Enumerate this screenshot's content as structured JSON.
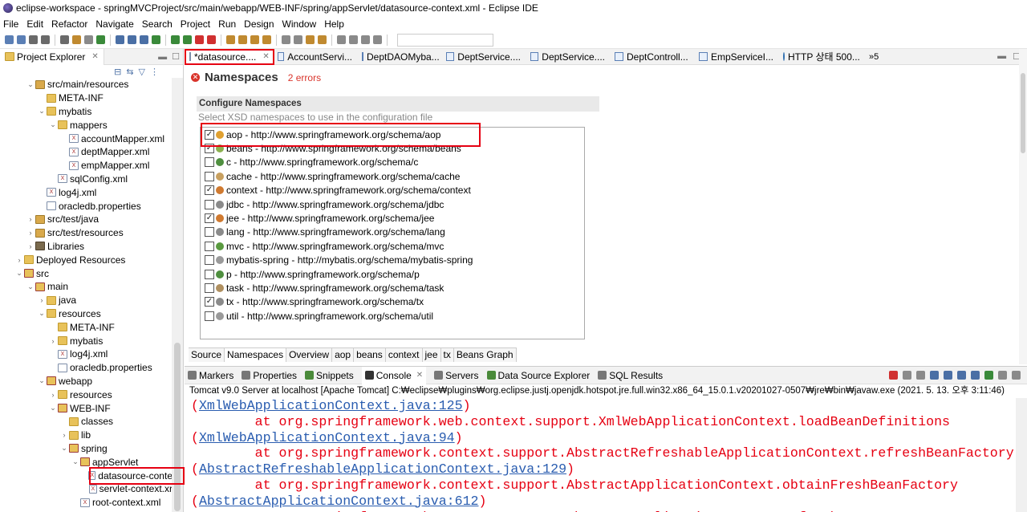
{
  "window": {
    "title": "eclipse-workspace - springMVCProject/src/main/webapp/WEB-INF/spring/appServlet/datasource-context.xml - Eclipse IDE"
  },
  "menu": [
    "File",
    "Edit",
    "Refactor",
    "Navigate",
    "Search",
    "Project",
    "Run",
    "Design",
    "Window",
    "Help"
  ],
  "explorer": {
    "tab_label": "Project Explorer",
    "tree": [
      {
        "label": "src/main/resources",
        "indent": 2,
        "arrow": "v",
        "icon": "pkg"
      },
      {
        "label": "META-INF",
        "indent": 3,
        "arrow": "",
        "icon": "folder"
      },
      {
        "label": "mybatis",
        "indent": 3,
        "arrow": "v",
        "icon": "folder"
      },
      {
        "label": "mappers",
        "indent": 4,
        "arrow": "v",
        "icon": "folder"
      },
      {
        "label": "accountMapper.xml",
        "indent": 5,
        "arrow": "",
        "icon": "xml"
      },
      {
        "label": "deptMapper.xml",
        "indent": 5,
        "arrow": "",
        "icon": "xml"
      },
      {
        "label": "empMapper.xml",
        "indent": 5,
        "arrow": "",
        "icon": "xml"
      },
      {
        "label": "sqlConfig.xml",
        "indent": 4,
        "arrow": "",
        "icon": "xml"
      },
      {
        "label": "log4j.xml",
        "indent": 3,
        "arrow": "",
        "icon": "xml"
      },
      {
        "label": "oracledb.properties",
        "indent": 3,
        "arrow": "",
        "icon": "file"
      },
      {
        "label": "src/test/java",
        "indent": 2,
        "arrow": ">",
        "icon": "pkg"
      },
      {
        "label": "src/test/resources",
        "indent": 2,
        "arrow": ">",
        "icon": "pkg"
      },
      {
        "label": "Libraries",
        "indent": 2,
        "arrow": ">",
        "icon": "lib"
      },
      {
        "label": "Deployed Resources",
        "indent": 1,
        "arrow": ">",
        "icon": "folder"
      },
      {
        "label": "src",
        "indent": 1,
        "arrow": "v",
        "icon": "src"
      },
      {
        "label": "main",
        "indent": 2,
        "arrow": "v",
        "icon": "src"
      },
      {
        "label": "java",
        "indent": 3,
        "arrow": ">",
        "icon": "folder"
      },
      {
        "label": "resources",
        "indent": 3,
        "arrow": "v",
        "icon": "folder"
      },
      {
        "label": "META-INF",
        "indent": 4,
        "arrow": "",
        "icon": "folder"
      },
      {
        "label": "mybatis",
        "indent": 4,
        "arrow": ">",
        "icon": "folder"
      },
      {
        "label": "log4j.xml",
        "indent": 4,
        "arrow": "",
        "icon": "xml"
      },
      {
        "label": "oracledb.properties",
        "indent": 4,
        "arrow": "",
        "icon": "file"
      },
      {
        "label": "webapp",
        "indent": 3,
        "arrow": "v",
        "icon": "src"
      },
      {
        "label": "resources",
        "indent": 4,
        "arrow": ">",
        "icon": "folder"
      },
      {
        "label": "WEB-INF",
        "indent": 4,
        "arrow": "v",
        "icon": "src"
      },
      {
        "label": "classes",
        "indent": 5,
        "arrow": "",
        "icon": "folder"
      },
      {
        "label": "lib",
        "indent": 5,
        "arrow": ">",
        "icon": "folder"
      },
      {
        "label": "spring",
        "indent": 5,
        "arrow": "v",
        "icon": "src"
      },
      {
        "label": "appServlet",
        "indent": 6,
        "arrow": "v",
        "icon": "src"
      },
      {
        "label": "datasource-conte",
        "indent": 7,
        "arrow": "",
        "icon": "xml"
      },
      {
        "label": "servlet-context.xr",
        "indent": 7,
        "arrow": "",
        "icon": "xml"
      },
      {
        "label": "root-context.xml",
        "indent": 6,
        "arrow": "",
        "icon": "xml"
      }
    ]
  },
  "editor": {
    "tabs": [
      {
        "label": "*datasource....",
        "icon": "xml",
        "active": true
      },
      {
        "label": "AccountServi...",
        "icon": "java"
      },
      {
        "label": "DeptDAOMyba...",
        "icon": "java"
      },
      {
        "label": "DeptService....",
        "icon": "java"
      },
      {
        "label": "DeptService....",
        "icon": "java"
      },
      {
        "label": "DeptControll...",
        "icon": "java"
      },
      {
        "label": "EmpServiceI...",
        "icon": "java"
      },
      {
        "label": "HTTP 상태 500...",
        "icon": "globe"
      }
    ],
    "overflow": "»5",
    "page_title": "Namespaces",
    "error_count": "2 errors",
    "section_title": "Configure Namespaces",
    "section_desc": "Select XSD namespaces to use in the configuration file",
    "namespaces": [
      {
        "label": "aop - http://www.springframework.org/schema/aop",
        "checked": true,
        "color": "#e0a030"
      },
      {
        "label": "beans - http://www.springframework.org/schema/beans",
        "checked": true,
        "color": "#8bb04f"
      },
      {
        "label": "c - http://www.springframework.org/schema/c",
        "checked": false,
        "color": "#4f8f3f"
      },
      {
        "label": "cache - http://www.springframework.org/schema/cache",
        "checked": false,
        "color": "#c8a060"
      },
      {
        "label": "context - http://www.springframework.org/schema/context",
        "checked": true,
        "color": "#d07a30"
      },
      {
        "label": "jdbc - http://www.springframework.org/schema/jdbc",
        "checked": false,
        "color": "#8a8a8a"
      },
      {
        "label": "jee - http://www.springframework.org/schema/jee",
        "checked": true,
        "color": "#d07a30"
      },
      {
        "label": "lang - http://www.springframework.org/schema/lang",
        "checked": false,
        "color": "#8a8a8a"
      },
      {
        "label": "mvc - http://www.springframework.org/schema/mvc",
        "checked": false,
        "color": "#5a9a40"
      },
      {
        "label": "mybatis-spring - http://mybatis.org/schema/mybatis-spring",
        "checked": false,
        "color": "#9a9a9a"
      },
      {
        "label": "p - http://www.springframework.org/schema/p",
        "checked": false,
        "color": "#4f8f3f"
      },
      {
        "label": "task - http://www.springframework.org/schema/task",
        "checked": false,
        "color": "#b09060"
      },
      {
        "label": "tx - http://www.springframework.org/schema/tx",
        "checked": true,
        "color": "#8a8a8a"
      },
      {
        "label": "util - http://www.springframework.org/schema/util",
        "checked": false,
        "color": "#9a9a9a"
      }
    ],
    "bottom_tabs": [
      "Source",
      "Namespaces",
      "Overview",
      "aop",
      "beans",
      "context",
      "jee",
      "tx",
      "Beans Graph"
    ]
  },
  "console": {
    "tabs": [
      {
        "label": "Markers",
        "color": "#777"
      },
      {
        "label": "Properties",
        "color": "#777"
      },
      {
        "label": "Snippets",
        "color": "#4a8a3a"
      },
      {
        "label": "Console",
        "color": "#333",
        "active": true
      },
      {
        "label": "Servers",
        "color": "#777"
      },
      {
        "label": "Data Source Explorer",
        "color": "#4a8a3a"
      },
      {
        "label": "SQL Results",
        "color": "#777"
      }
    ],
    "status": "Tomcat v9.0 Server at localhost [Apache Tomcat] C:₩eclipse₩plugins₩org.eclipse.justj.openjdk.hotspot.jre.full.win32.x86_64_15.0.1.v20201027-0507₩jre₩bin₩javaw.exe  (2021. 5. 13. 오후 3:11:46)",
    "lines": [
      {
        "pre": "(",
        "link": "XmlWebApplicationContext.java:125",
        "post": ")"
      },
      {
        "pre": "        at org.springframework.web.context.support.XmlWebApplicationContext.loadBeanDefinitions",
        "link": "",
        "post": ""
      },
      {
        "pre": "(",
        "link": "XmlWebApplicationContext.java:94",
        "post": ")"
      },
      {
        "pre": "        at org.springframework.context.support.AbstractRefreshableApplicationContext.refreshBeanFactory",
        "link": "",
        "post": ""
      },
      {
        "pre": "(",
        "link": "AbstractRefreshableApplicationContext.java:129",
        "post": ")"
      },
      {
        "pre": "        at org.springframework.context.support.AbstractApplicationContext.obtainFreshBeanFactory",
        "link": "",
        "post": ""
      },
      {
        "pre": "(",
        "link": "AbstractApplicationContext.java:612",
        "post": ")"
      },
      {
        "pre": "        at org.springframework.context.support.AbstractApplicationContext.refresh",
        "link": "",
        "post": ""
      }
    ]
  }
}
